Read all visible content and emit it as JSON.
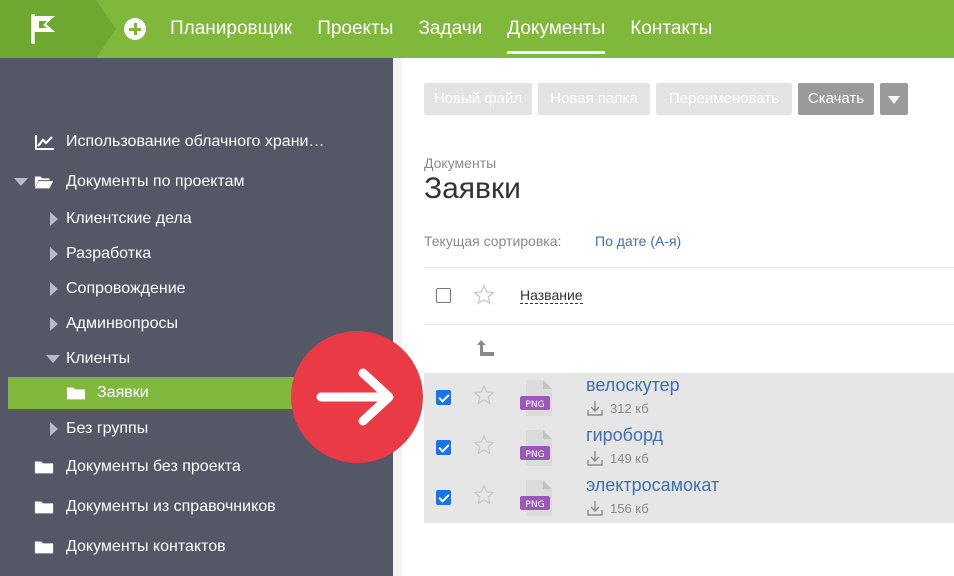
{
  "topbar": {
    "nav": [
      "Планировщик",
      "Проекты",
      "Задачи",
      "Документы",
      "Контакты"
    ],
    "active_index": 3
  },
  "sidebar": {
    "items": [
      {
        "label": "Использование облачного храни…",
        "icon": "chart-icon"
      },
      {
        "label": "Документы по проектам",
        "icon": "folder-open-icon",
        "expanded": true
      },
      {
        "label": "Клиентские дела",
        "icon": "caret-right-icon"
      },
      {
        "label": "Разработка",
        "icon": "caret-right-icon"
      },
      {
        "label": "Сопровождение",
        "icon": "caret-right-icon"
      },
      {
        "label": "Админвопросы",
        "icon": "caret-right-icon"
      },
      {
        "label": "Клиенты",
        "icon": "caret-down-icon",
        "expanded": true
      },
      {
        "label": "Заявки",
        "icon": "folder-icon",
        "active": true
      },
      {
        "label": "Без группы",
        "icon": "caret-right-icon"
      },
      {
        "label": "Документы без проекта",
        "icon": "folder-icon"
      },
      {
        "label": "Документы из справочников",
        "icon": "folder-icon"
      },
      {
        "label": "Документы контактов",
        "icon": "folder-icon"
      }
    ]
  },
  "toolbar": {
    "new_file": "Новый файл",
    "new_folder": "Новая папка",
    "rename": "Переименовать",
    "download": "Скачать"
  },
  "main": {
    "breadcrumb": "Документы",
    "title": "Заявки",
    "sort_label": "Текущая сортировка:",
    "sort_value": "По дате (А-я)",
    "column_name": "Название",
    "files": [
      {
        "name": "велоскутер",
        "size": "312 кб",
        "type": "PNG",
        "checked": true
      },
      {
        "name": "гироборд",
        "size": "149 кб",
        "type": "PNG",
        "checked": true
      },
      {
        "name": "электросамокат",
        "size": "156 кб",
        "type": "PNG",
        "checked": true
      }
    ]
  },
  "colors": {
    "brand_green": "#7fb83b",
    "sidebar_bg": "#535766",
    "link_blue": "#3f6eb3",
    "badge_red": "#ea3a45",
    "file_purple": "#9b59b6"
  }
}
